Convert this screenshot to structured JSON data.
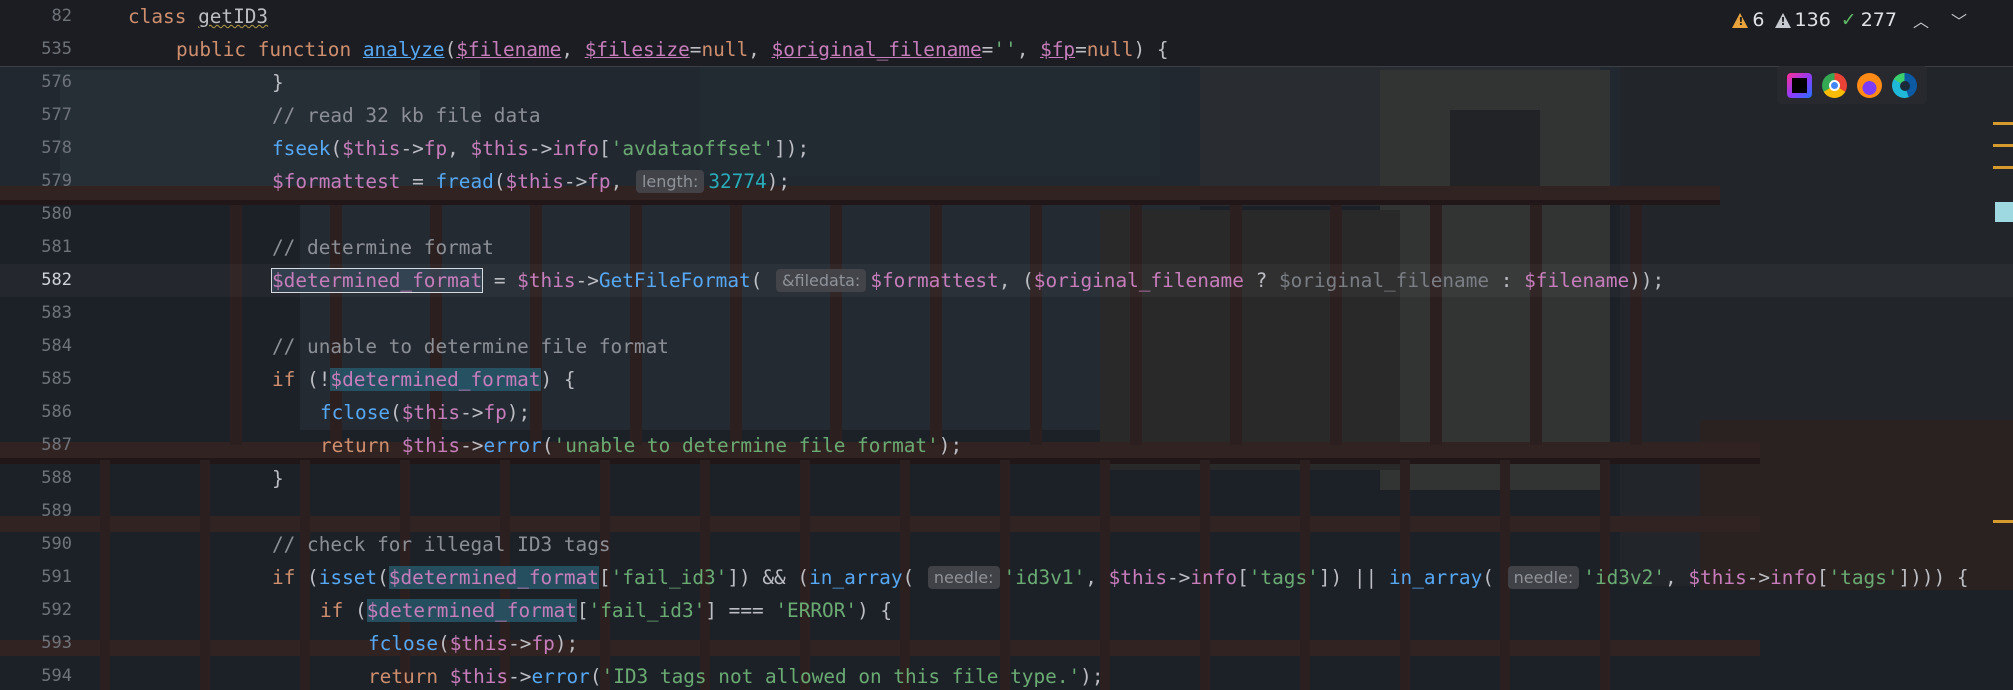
{
  "sticky": {
    "line1_no": "82",
    "line1_kw": "class",
    "line1_name": "getID3",
    "line2_no": "535",
    "line2_public": "public",
    "line2_function": "function",
    "line2_fn": "analyze",
    "p1": "$filename",
    "p2": "$filesize",
    "null1": "null",
    "p3": "$original_filename",
    "p3_default": "''",
    "p4": "$fp",
    "null2": "null"
  },
  "inspections": {
    "warnings": "6",
    "weak_warnings": "136",
    "ok": "277"
  },
  "lines": {
    "n576": "576",
    "n577": "577",
    "n578": "578",
    "n579": "579",
    "n580": "580",
    "n581": "581",
    "n582": "582",
    "n583": "583",
    "n584": "584",
    "n585": "585",
    "n586": "586",
    "n587": "587",
    "n588": "588",
    "n589": "589",
    "n590": "590",
    "n591": "591",
    "n592": "592",
    "n593": "593",
    "n594": "594",
    "c577": "// read 32 kb file data",
    "c581": "// determine format",
    "c584": "// unable to determine file format",
    "c590": "// check for illegal ID3 tags",
    "fseek": "fseek",
    "fread": "fread",
    "fclose": "fclose",
    "isset": "isset",
    "in_array": "in_array",
    "if": "if",
    "return": "return",
    "this": "$this",
    "fp": "fp",
    "info": "info",
    "error": "error",
    "GetFileFormat": "GetFileFormat",
    "s_avdataoffset": "'avdataoffset'",
    "v_formattest": "$formattest",
    "hint_length": "length:",
    "num_32774": "32774",
    "v_determined_format": "$determined_format",
    "hint_filedata": "&filedata:",
    "v_original_filename": "$original_filename",
    "v_filename": "$filename",
    "s_unable": "'unable to determine file format'",
    "s_fail_id3": "'fail_id3'",
    "hint_needle": "needle:",
    "s_id3v1": "'id3v1'",
    "s_id3v2": "'id3v2'",
    "s_tags": "'tags'",
    "s_ERROR": "'ERROR'",
    "s_id3_not_allowed": "'ID3 tags not allowed on this file type.'"
  },
  "colors": {
    "keyword": "#cf8e6d",
    "function": "#56a8f5",
    "variable": "#c77dbb",
    "string": "#6aab73",
    "number": "#2aacb8",
    "comment": "#8c8f96",
    "warning": "#e8a33d"
  },
  "browser_icons": [
    "phpstorm-icon",
    "chrome-icon",
    "firefox-icon",
    "edge-icon"
  ]
}
